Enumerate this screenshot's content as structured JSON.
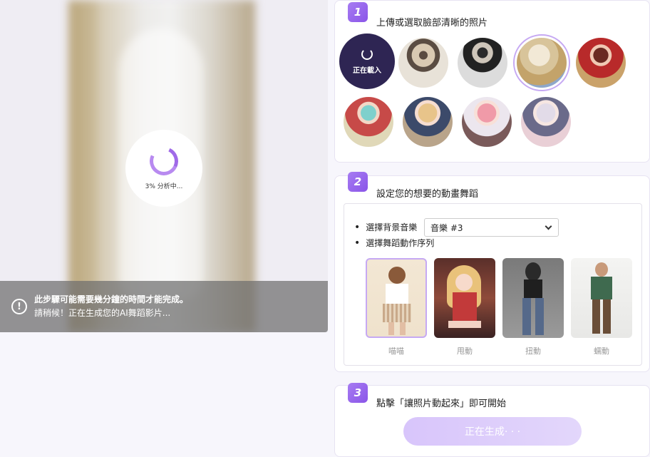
{
  "preview": {
    "progress_text": "3% 分析中...",
    "notice_line1": "此步驟可能需要幾分鐘的時間才能完成。",
    "notice_line2": "請稍候！正在生成您的AI舞蹈影片..."
  },
  "step1": {
    "number": "1",
    "title": "上傳或選取臉部清晰的照片",
    "loading_label": "正在載入"
  },
  "step2": {
    "number": "2",
    "title": "設定您的想要的動畫舞蹈",
    "music_label": "選擇背景音樂",
    "music_value": "音樂 #3",
    "dance_label": "選擇舞蹈動作序列",
    "dances": [
      {
        "label": "喵喵"
      },
      {
        "label": "甩動"
      },
      {
        "label": "扭動"
      },
      {
        "label": "蠕動"
      }
    ]
  },
  "step3": {
    "number": "3",
    "title": "點擊「讓照片動起來」即可開始",
    "button_label": "正在生成· · ·"
  }
}
